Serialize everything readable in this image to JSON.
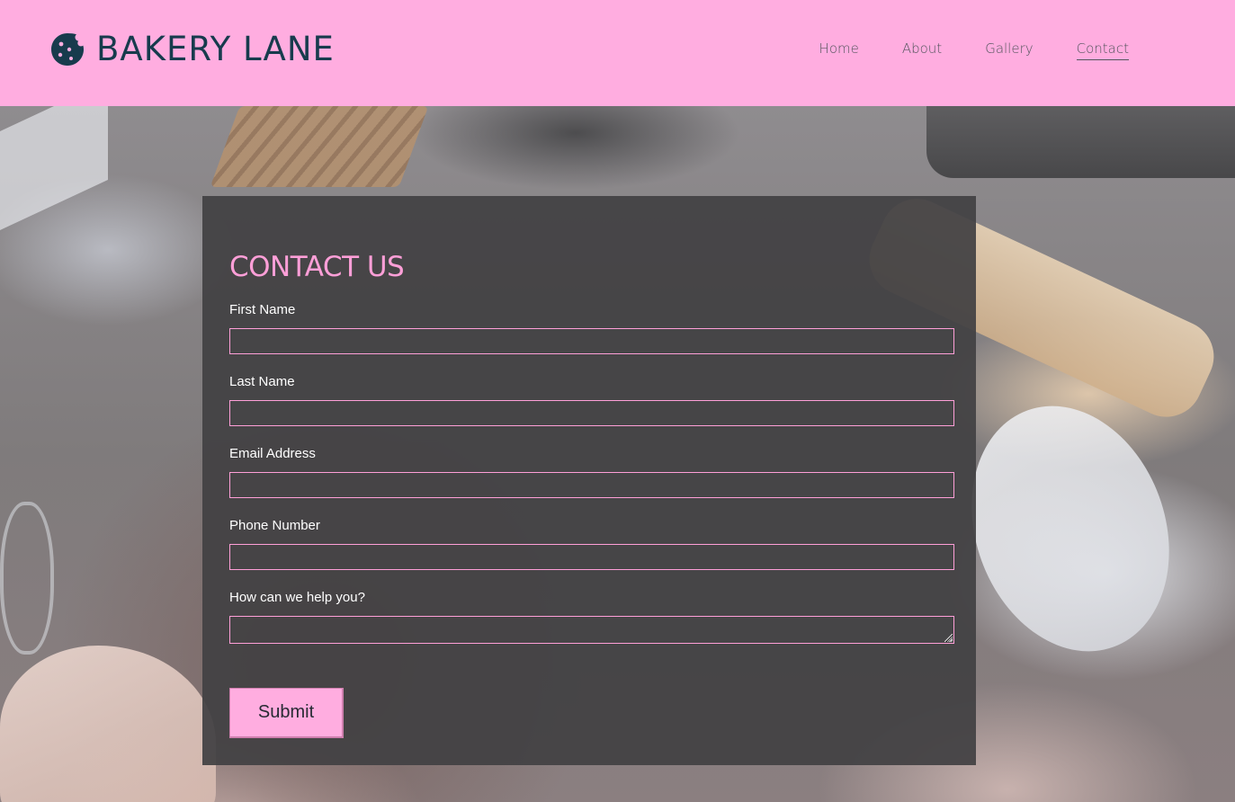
{
  "brand": {
    "name": "BAKERY LANE",
    "icon": "cookie-icon",
    "text_color": "#173b4d",
    "header_bg": "#ffade0"
  },
  "nav": {
    "items": [
      {
        "label": "Home"
      },
      {
        "label": "About"
      },
      {
        "label": "Gallery"
      },
      {
        "label": "Contact",
        "active": true
      }
    ]
  },
  "form": {
    "title": "CONTACT US",
    "accent": "#ff9fd8",
    "fields": [
      {
        "label": "First Name",
        "value": "",
        "placeholder": ""
      },
      {
        "label": "Last Name",
        "value": "",
        "placeholder": ""
      },
      {
        "label": "Email Address",
        "value": "",
        "placeholder": ""
      },
      {
        "label": "Phone Number",
        "value": "",
        "placeholder": ""
      },
      {
        "label": "How can we help you?",
        "value": "",
        "placeholder": ""
      }
    ],
    "submit_label": "Submit"
  }
}
